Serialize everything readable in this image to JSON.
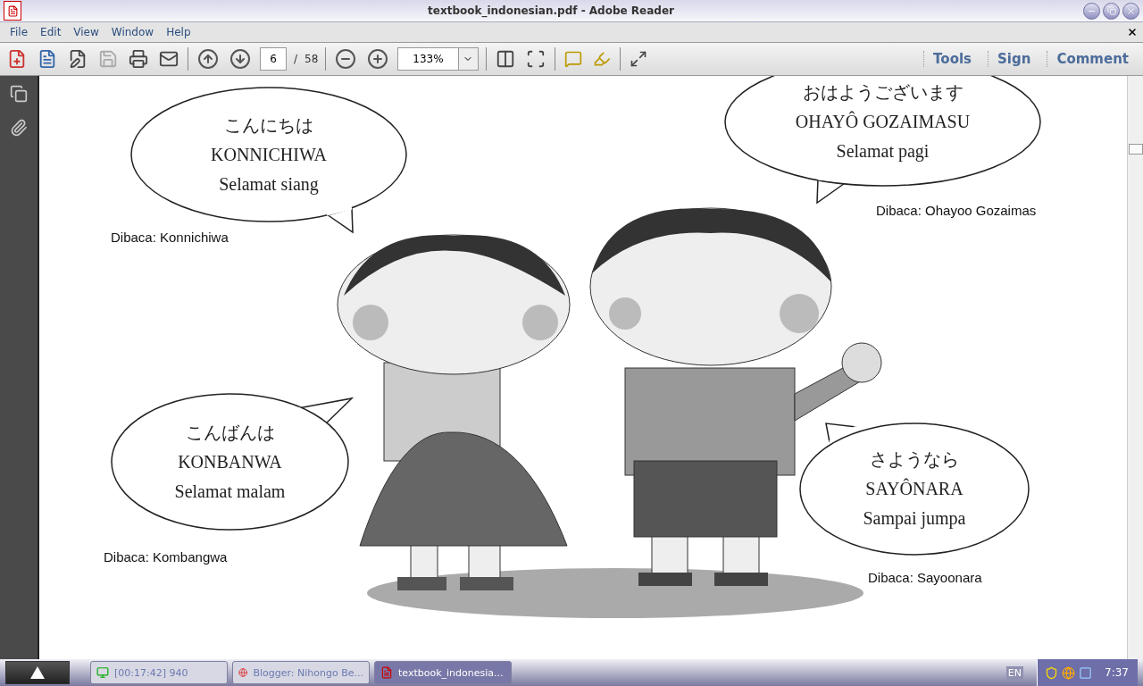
{
  "window": {
    "title": "textbook_indonesian.pdf - Adobe Reader"
  },
  "menu": [
    "File",
    "Edit",
    "View",
    "Window",
    "Help"
  ],
  "toolbar": {
    "page_number": "6",
    "page_separator": "/",
    "page_count": "58",
    "zoom": "133%",
    "panels": [
      "Tools",
      "Sign",
      "Comment"
    ]
  },
  "page": {
    "bubbles": [
      {
        "lines": [
          "こんにちは",
          "KONNICHIWA",
          "Selamat siang"
        ],
        "caption": "Dibaca: Konnichiwa"
      },
      {
        "lines": [
          "おはようございます",
          "OHAYÔ GOZAIMASU",
          "Selamat pagi"
        ],
        "caption": "Dibaca: Ohayoo Gozaimas"
      },
      {
        "lines": [
          "こんばんは",
          "KONBANWA",
          "Selamat malam"
        ],
        "caption": "Dibaca: Kombangwa"
      },
      {
        "lines": [
          "さようなら",
          "SAYÔNARA",
          "Sampai jumpa"
        ],
        "caption": "Dibaca: Sayoonara"
      }
    ]
  },
  "taskbar": {
    "tasks": [
      {
        "kind": "monitor",
        "label": "[00:17:42] 940",
        "selected": false
      },
      {
        "kind": "browser",
        "label": "Blogger: Nihongo Be...",
        "selected": false
      },
      {
        "kind": "pdf",
        "label": "textbook_indonesia...",
        "selected": true
      }
    ],
    "language": "EN",
    "clock": "7:37"
  }
}
